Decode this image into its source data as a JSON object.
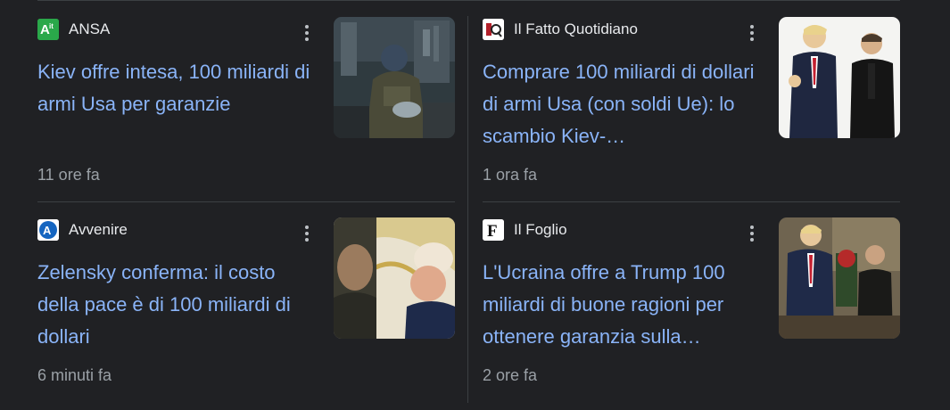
{
  "cards": [
    {
      "source": "ANSA",
      "headline": "Kiev offre intesa, 100 miliardi di armi Usa per garanzie",
      "time": "11 ore fa",
      "logo_icon": "ansa-logo-icon",
      "thumbnail": "soldier-weapons-image"
    },
    {
      "source": "Il Fatto Quotidiano",
      "headline": "Comprare 100 miliardi di dollari di armi Usa (con soldi Ue): lo scambio Kiev-…",
      "time": "1 ora fa",
      "logo_icon": "ilfatto-logo-icon",
      "thumbnail": "trump-zelensky-handshake-image"
    },
    {
      "source": "Avvenire",
      "headline": "Zelensky conferma: il costo della pace è di 100 miliardi di dollari",
      "time": "6 minuti fa",
      "logo_icon": "avvenire-logo-icon",
      "thumbnail": "zelensky-trump-meeting-image"
    },
    {
      "source": "Il Foglio",
      "headline": "L'Ucraina offre a Trump 100 miliardi di buone ragioni per ottenere garanzia sulla…",
      "time": "2 ore fa",
      "logo_icon": "ilfoglio-logo-icon",
      "thumbnail": "trump-zelensky-office-image"
    }
  ],
  "colors": {
    "background": "#202124",
    "headline": "#8ab4f8",
    "source": "#e8eaed",
    "time": "#9aa0a6",
    "divider": "#3c4043"
  }
}
